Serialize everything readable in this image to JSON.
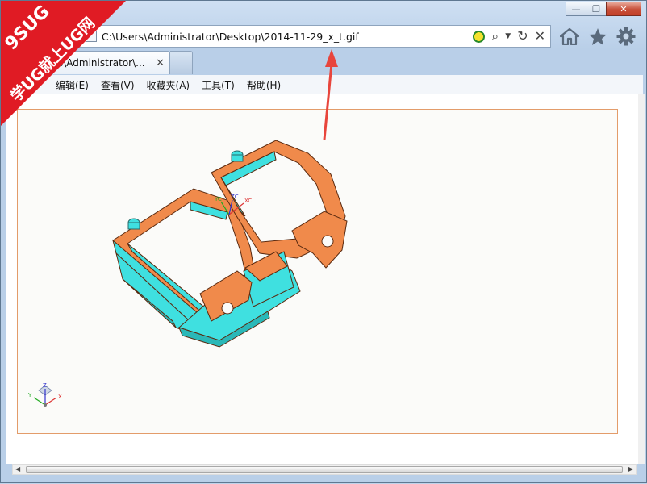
{
  "window": {
    "controls": {
      "minimize": "—",
      "restore": "❐",
      "close": "✕"
    }
  },
  "address_bar": {
    "url": "C:\\Users\\Administrator\\Desktop\\2014-11-29_x_t.gif",
    "search_icon": "search-icon",
    "dropdown_icon": "chevron-down-icon",
    "refresh_icon": "refresh-icon",
    "stop_icon": "close-icon"
  },
  "toolbar_icons": [
    "home-icon",
    "star-icon",
    "gear-icon"
  ],
  "tab": {
    "title": "s\\Administrator\\...",
    "close": "✕"
  },
  "menu": {
    "items": [
      "编辑(E)",
      "查看(V)",
      "收藏夹(A)",
      "工具(T)",
      "帮助(H)"
    ]
  },
  "watermark": {
    "line1": "9SUG",
    "line2": "学UG就上UG网",
    "bg_color": "#e01b24"
  },
  "annotation": {
    "arrow_color": "#e8453c"
  },
  "model": {
    "colors": {
      "orange": "#f08a4b",
      "cyan": "#3fe0e0",
      "outline": "#5a2a10"
    },
    "triad_labels": {
      "x": "XC",
      "y": "YC",
      "z": "ZC"
    }
  },
  "corner_triad": {
    "x": "X",
    "y": "Y",
    "z": "Z"
  }
}
